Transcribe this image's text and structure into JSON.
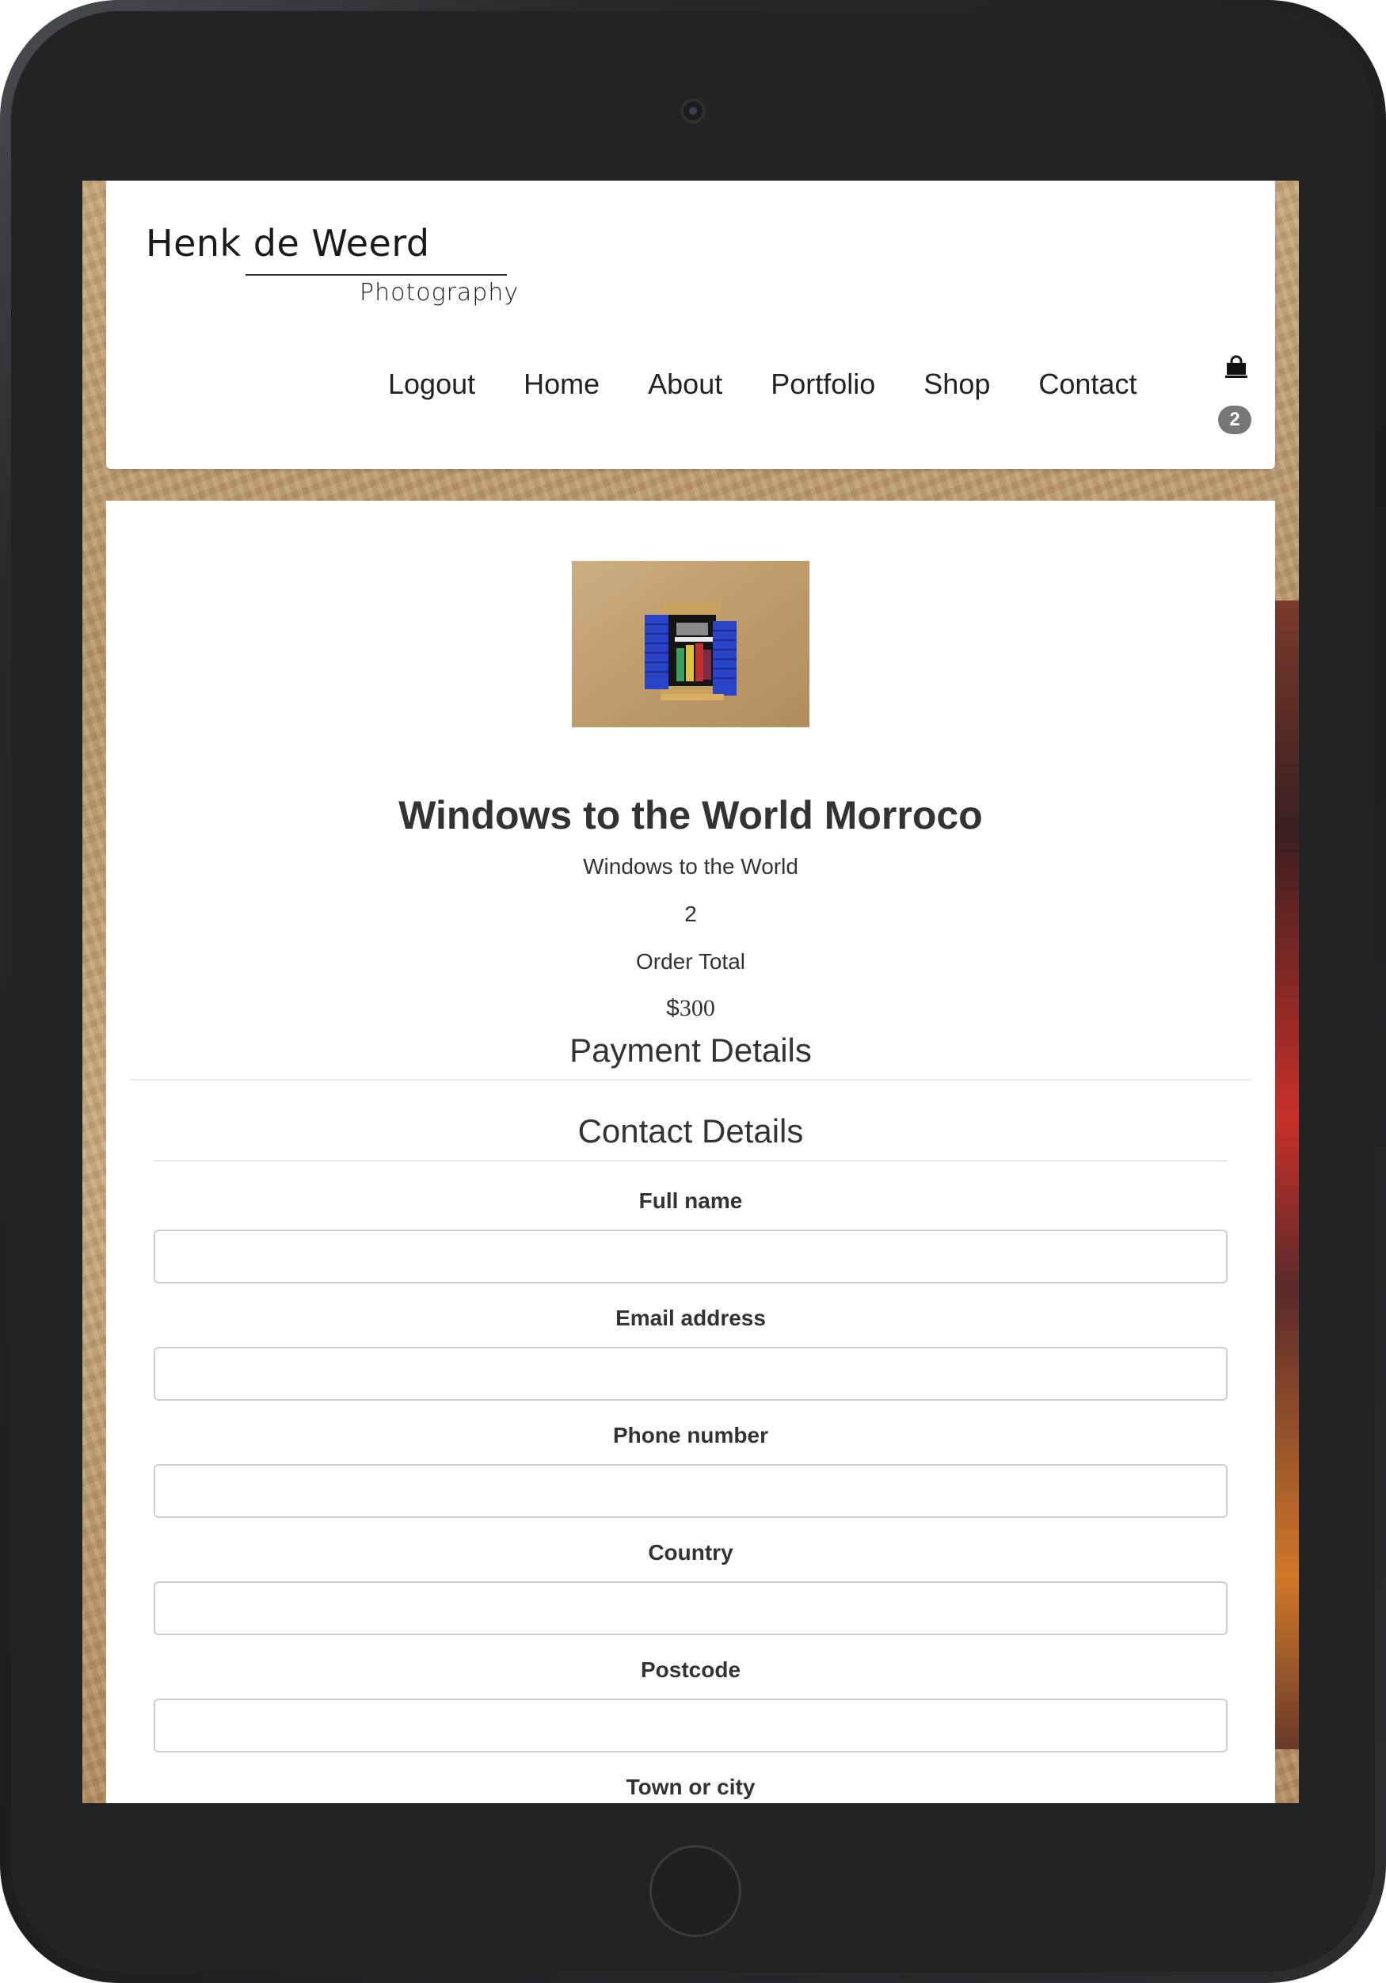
{
  "site": {
    "logo_name": "Henk de Weerd",
    "logo_sub": "Photography"
  },
  "nav": {
    "items": [
      {
        "label": "Logout"
      },
      {
        "label": "Home"
      },
      {
        "label": "About"
      },
      {
        "label": "Portfolio"
      },
      {
        "label": "Shop"
      },
      {
        "label": "Contact"
      }
    ]
  },
  "cart": {
    "icon": "shopping-bag-icon",
    "count": "2"
  },
  "product": {
    "title": "Windows to the World Morroco",
    "subtitle": "Windows to the World",
    "quantity": "2",
    "total_label": "Order Total",
    "total_currency": "$",
    "total_amount": "300"
  },
  "payment": {
    "heading": "Payment Details",
    "contact_heading": "Contact Details",
    "fields": [
      {
        "label": "Full name",
        "value": ""
      },
      {
        "label": "Email address",
        "value": ""
      },
      {
        "label": "Phone number",
        "value": ""
      },
      {
        "label": "Country",
        "value": ""
      },
      {
        "label": "Postcode",
        "value": ""
      },
      {
        "label": "Town or city",
        "value": ""
      }
    ]
  },
  "colors": {
    "badge": "#777777",
    "text": "#333333",
    "input_border": "#cfcfcf",
    "shutter_blue": "#2a44c8"
  }
}
